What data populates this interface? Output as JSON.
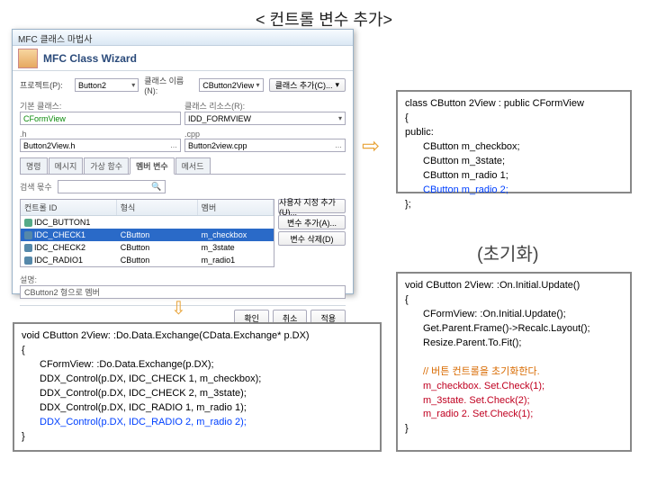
{
  "slide_title": "< 컨트롤 변수 추가>",
  "wizard": {
    "title": "MFC 클래스 마법사",
    "banner": "MFC Class Wizard",
    "labels": {
      "project": "프로젝트(P):",
      "class": "클래스 이름(N):",
      "base": "기본 클래스:",
      "resource": "클래스 리소스(R):",
      "decl_h": ".h",
      "impl": ".cpp"
    },
    "project": "Button2",
    "class": "CButton2View",
    "base": "CFormView",
    "resource": "IDD_FORMVIEW",
    "decl_file": "Button2View.h",
    "impl_file": "Button2view.cpp",
    "add_class_btn": "클래스 추가(C)...",
    "tabs": [
      "명령",
      "메시지",
      "가상 함수",
      "멤버 변수",
      "메서드"
    ],
    "active_tab": 3,
    "search_label": "검색 몫수",
    "side_buttons": [
      "사용자 지정 추가(U)...",
      "변수 추가(A)...",
      "변수 삭제(D)"
    ],
    "table": {
      "headers": [
        "컨트롤 ID",
        "형식",
        "멤버"
      ],
      "rows": [
        {
          "id": "IDC_BUTTON1",
          "type": "",
          "member": "",
          "selected": false,
          "green": true
        },
        {
          "id": "IDC_CHECK1",
          "type": "CButton",
          "member": "m_checkbox",
          "selected": true,
          "green": false
        },
        {
          "id": "IDC_CHECK2",
          "type": "CButton",
          "member": "m_3state",
          "selected": false,
          "green": false
        },
        {
          "id": "IDC_RADIO1",
          "type": "CButton",
          "member": "m_radio1",
          "selected": false,
          "green": false
        }
      ]
    },
    "desc_label": "설명:",
    "desc_value": "CButton2 형으로 멤버",
    "footer": [
      "확인",
      "취소",
      "적용"
    ]
  },
  "code1": {
    "l1": "class CButton 2View : public CFormView",
    "l2": "{",
    "l3": "public:",
    "m1": "CButton m_checkbox;",
    "m2": "CButton m_3state;",
    "m3": "CButton m_radio 1;",
    "m4": "CButton m_radio 2;",
    "l4": "};"
  },
  "init_label": "(초기화)",
  "code2": {
    "l1": "void CButton 2View: :On.Initial.Update()",
    "l2": "{",
    "b1": "CFormView: :On.Initial.Update();",
    "b2": "Get.Parent.Frame()->Recalc.Layout();",
    "b3": "Resize.Parent.To.Fit();",
    "c1": "// 버튼 컨트롤을 초기화한다.",
    "d1": "m_checkbox. Set.Check(1);",
    "d2": "m_3state. Set.Check(2);",
    "d3": "m_radio 2. Set.Check(1);",
    "l3": "}"
  },
  "code3": {
    "l1": "void CButton 2View: :Do.Data.Exchange(CData.Exchange* p.DX)",
    "l2": "{",
    "b1": "CFormView: :Do.Data.Exchange(p.DX);",
    "b2": "DDX_Control(p.DX, IDC_CHECK 1, m_checkbox);",
    "b3": "DDX_Control(p.DX, IDC_CHECK 2, m_3state);",
    "b4": "DDX_Control(p.DX, IDC_RADIO 1, m_radio 1);",
    "b5": "DDX_Control(p.DX, IDC_RADIO 2, m_radio 2);",
    "l3": "}"
  }
}
